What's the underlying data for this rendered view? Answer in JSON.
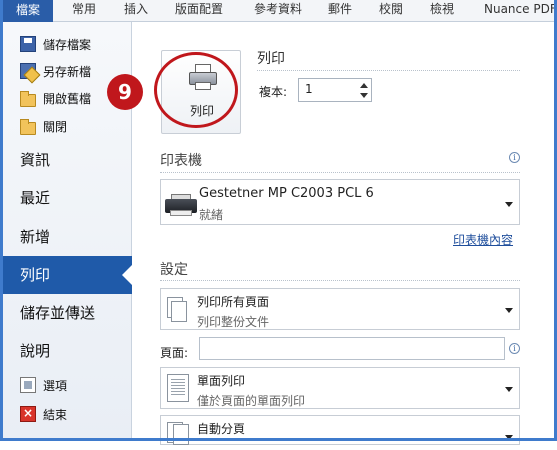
{
  "ribbon": {
    "file_tab": "檔案",
    "tabs": [
      "常用",
      "插入",
      "版面配置",
      "參考資料",
      "郵件",
      "校閱",
      "檢視",
      "Nuance PDF"
    ]
  },
  "sidebar": {
    "save": "儲存檔案",
    "save_as": "另存新檔",
    "open": "開啟舊檔",
    "close": "關閉",
    "info": "資訊",
    "recent": "最近",
    "new": "新增",
    "print": "列印",
    "save_send": "儲存並傳送",
    "help": "說明",
    "options": "選項",
    "exit": "結束"
  },
  "print_panel": {
    "step_number": "9",
    "print_button_label": "列印",
    "title": "列印",
    "copies_label": "複本:",
    "copies_value": "1"
  },
  "printer": {
    "section_title": "印表機",
    "name": "Gestetner MP C2003 PCL 6",
    "status": "就緒",
    "properties_link": "印表機內容"
  },
  "settings": {
    "section_title": "設定",
    "range_main": "列印所有頁面",
    "range_sub": "列印整份文件",
    "pages_label": "頁面:",
    "pages_value": "",
    "sides_main": "單面列印",
    "sides_sub": "僅於頁面的單面列印",
    "collate_main": "自動分頁"
  },
  "colors": {
    "accent": "#1f5aa9",
    "badge": "#c0171c"
  }
}
